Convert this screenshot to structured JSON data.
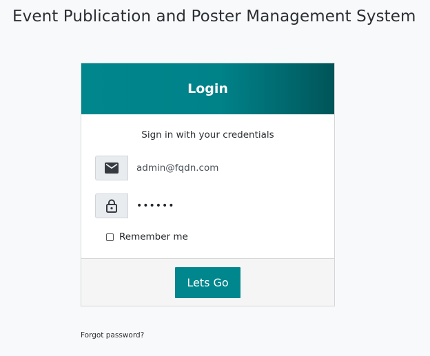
{
  "page": {
    "title": "Event Publication and Poster Management System"
  },
  "login_card": {
    "header_title": "Login",
    "subtitle": "Sign in with your credentials",
    "email": {
      "value": "admin@fqdn.com",
      "icon": "envelope-icon"
    },
    "password": {
      "value": "••••••",
      "icon": "lock-icon"
    },
    "remember_label": "Remember me",
    "remember_checked": false,
    "submit_label": "Lets Go"
  },
  "forgot_password_label": "Forgot password?",
  "colors": {
    "accent": "#00868d",
    "accent_dark": "#005458",
    "background": "#f8f9fa"
  }
}
